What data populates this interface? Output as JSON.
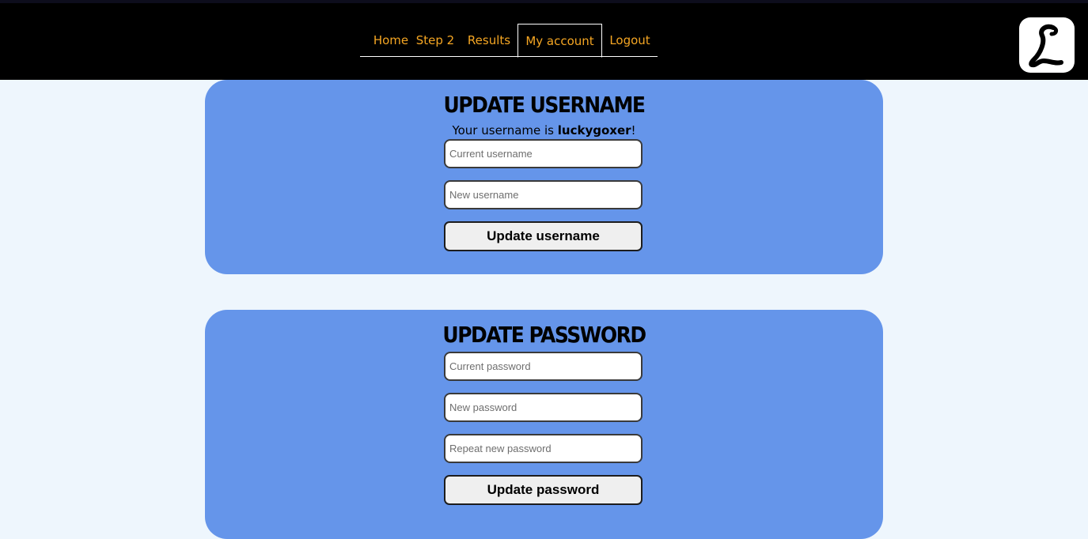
{
  "nav": {
    "items": [
      {
        "label": "Home",
        "active": false
      },
      {
        "label": "Step 2",
        "active": false
      },
      {
        "label": "Results",
        "active": false
      },
      {
        "label": "My account",
        "active": true
      },
      {
        "label": "Logout",
        "active": false
      }
    ],
    "link_color": "#f5a623",
    "background": "#000000"
  },
  "logo": {
    "letter": "L",
    "icon": "logo-icon"
  },
  "username_card": {
    "title": "Update username",
    "info_prefix": "Your username is ",
    "username": "luckygoxer",
    "info_suffix": "!",
    "current_placeholder": "Current username",
    "new_placeholder": "New username",
    "button_label": "Update username"
  },
  "password_card": {
    "title": "Update password",
    "current_placeholder": "Current password",
    "new_placeholder": "New password",
    "repeat_placeholder": "Repeat new password",
    "button_label": "Update password"
  },
  "colors": {
    "page_background": "#eef6fd",
    "card_background": "#6595ea"
  }
}
